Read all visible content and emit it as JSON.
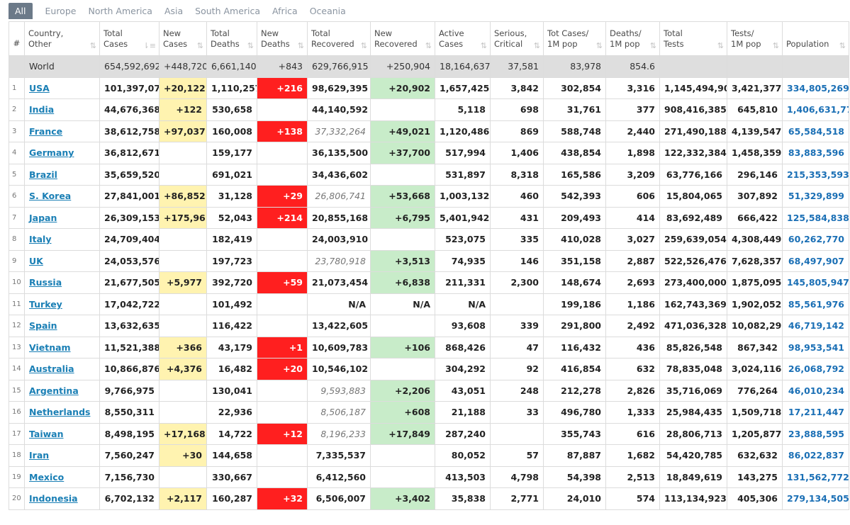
{
  "tabs": [
    {
      "label": "All",
      "active": true
    },
    {
      "label": "Europe",
      "active": false
    },
    {
      "label": "North America",
      "active": false
    },
    {
      "label": "Asia",
      "active": false
    },
    {
      "label": "South America",
      "active": false
    },
    {
      "label": "Africa",
      "active": false
    },
    {
      "label": "Oceania",
      "active": false
    }
  ],
  "headers": [
    [
      "#",
      ""
    ],
    [
      "Country,",
      "Other"
    ],
    [
      "Total",
      "Cases"
    ],
    [
      "New",
      "Cases"
    ],
    [
      "Total",
      "Deaths"
    ],
    [
      "New",
      "Deaths"
    ],
    [
      "Total",
      "Recovered"
    ],
    [
      "New",
      "Recovered"
    ],
    [
      "Active",
      "Cases"
    ],
    [
      "Serious,",
      "Critical"
    ],
    [
      "Tot Cases/",
      "1M pop"
    ],
    [
      "Deaths/",
      "1M pop"
    ],
    [
      "Total",
      "Tests"
    ],
    [
      "Tests/",
      "1M pop"
    ],
    [
      "",
      "Population"
    ]
  ],
  "world": [
    "",
    "World",
    "654,592,692",
    "+448,720",
    "6,661,140",
    "+843",
    "629,766,915",
    "+250,904",
    "18,164,637",
    "37,581",
    "83,978",
    "854.6",
    "",
    "",
    ""
  ],
  "rows": [
    [
      "1",
      "USA",
      "101,397,077",
      "+20,122",
      "1,110,257",
      "+216",
      "98,629,395",
      "+20,902",
      "1,657,425",
      "3,842",
      "302,854",
      "3,316",
      "1,145,494,902",
      "3,421,377",
      "334,805,269"
    ],
    [
      "2",
      "India",
      "44,676,368",
      "+122",
      "530,658",
      "",
      "44,140,592",
      "",
      "5,118",
      "698",
      "31,761",
      "377",
      "908,416,385",
      "645,810",
      "1,406,631,776"
    ],
    [
      "3",
      "France",
      "38,612,758",
      "+97,037",
      "160,008",
      "+138",
      "37,332,264",
      "+49,021",
      "1,120,486",
      "869",
      "588,748",
      "2,440",
      "271,490,188",
      "4,139,547",
      "65,584,518"
    ],
    [
      "4",
      "Germany",
      "36,812,671",
      "",
      "159,177",
      "",
      "36,135,500",
      "+37,700",
      "517,994",
      "1,406",
      "438,854",
      "1,898",
      "122,332,384",
      "1,458,359",
      "83,883,596"
    ],
    [
      "5",
      "Brazil",
      "35,659,520",
      "",
      "691,021",
      "",
      "34,436,602",
      "",
      "531,897",
      "8,318",
      "165,586",
      "3,209",
      "63,776,166",
      "296,146",
      "215,353,593"
    ],
    [
      "6",
      "S. Korea",
      "27,841,001",
      "+86,852",
      "31,128",
      "+29",
      "26,806,741",
      "+53,668",
      "1,003,132",
      "460",
      "542,393",
      "606",
      "15,804,065",
      "307,892",
      "51,329,899"
    ],
    [
      "7",
      "Japan",
      "26,309,153",
      "+175,961",
      "52,043",
      "+214",
      "20,855,168",
      "+6,795",
      "5,401,942",
      "431",
      "209,493",
      "414",
      "83,692,489",
      "666,422",
      "125,584,838"
    ],
    [
      "8",
      "Italy",
      "24,709,404",
      "",
      "182,419",
      "",
      "24,003,910",
      "",
      "523,075",
      "335",
      "410,028",
      "3,027",
      "259,639,054",
      "4,308,449",
      "60,262,770"
    ],
    [
      "9",
      "UK",
      "24,053,576",
      "",
      "197,723",
      "",
      "23,780,918",
      "+3,513",
      "74,935",
      "146",
      "351,158",
      "2,887",
      "522,526,476",
      "7,628,357",
      "68,497,907"
    ],
    [
      "10",
      "Russia",
      "21,677,505",
      "+5,977",
      "392,720",
      "+59",
      "21,073,454",
      "+6,838",
      "211,331",
      "2,300",
      "148,674",
      "2,693",
      "273,400,000",
      "1,875,095",
      "145,805,947"
    ],
    [
      "11",
      "Turkey",
      "17,042,722",
      "",
      "101,492",
      "",
      "N/A",
      "N/A",
      "N/A",
      "",
      "199,186",
      "1,186",
      "162,743,369",
      "1,902,052",
      "85,561,976"
    ],
    [
      "12",
      "Spain",
      "13,632,635",
      "",
      "116,422",
      "",
      "13,422,605",
      "",
      "93,608",
      "339",
      "291,800",
      "2,492",
      "471,036,328",
      "10,082,298",
      "46,719,142"
    ],
    [
      "13",
      "Vietnam",
      "11,521,388",
      "+366",
      "43,179",
      "+1",
      "10,609,783",
      "+106",
      "868,426",
      "47",
      "116,432",
      "436",
      "85,826,548",
      "867,342",
      "98,953,541"
    ],
    [
      "14",
      "Australia",
      "10,866,876",
      "+4,376",
      "16,482",
      "+20",
      "10,546,102",
      "",
      "304,292",
      "92",
      "416,854",
      "632",
      "78,835,048",
      "3,024,116",
      "26,068,792"
    ],
    [
      "15",
      "Argentina",
      "9,766,975",
      "",
      "130,041",
      "",
      "9,593,883",
      "+2,206",
      "43,051",
      "248",
      "212,278",
      "2,826",
      "35,716,069",
      "776,264",
      "46,010,234"
    ],
    [
      "16",
      "Netherlands",
      "8,550,311",
      "",
      "22,936",
      "",
      "8,506,187",
      "+608",
      "21,188",
      "33",
      "496,780",
      "1,333",
      "25,984,435",
      "1,509,718",
      "17,211,447"
    ],
    [
      "17",
      "Taiwan",
      "8,498,195",
      "+17,168",
      "14,722",
      "+12",
      "8,196,233",
      "+17,849",
      "287,240",
      "",
      "355,743",
      "616",
      "28,806,713",
      "1,205,877",
      "23,888,595"
    ],
    [
      "18",
      "Iran",
      "7,560,247",
      "+30",
      "144,658",
      "",
      "7,335,537",
      "",
      "80,052",
      "57",
      "87,887",
      "1,682",
      "54,420,785",
      "632,632",
      "86,022,837"
    ],
    [
      "19",
      "Mexico",
      "7,156,730",
      "",
      "330,667",
      "",
      "6,412,560",
      "",
      "413,503",
      "4,798",
      "54,398",
      "2,513",
      "18,849,619",
      "143,275",
      "131,562,772"
    ],
    [
      "20",
      "Indonesia",
      "6,702,132",
      "+2,117",
      "160,287",
      "+32",
      "6,506,007",
      "+3,402",
      "35,838",
      "2,771",
      "24,010",
      "574",
      "113,134,923",
      "405,306",
      "279,134,505"
    ]
  ],
  "italic_recovered_rows": [
    "France",
    "S. Korea",
    "UK",
    "Argentina",
    "Netherlands",
    "Taiwan"
  ],
  "colors": {
    "new_cases": "#fff3b0",
    "new_deaths": "#ff1f1f",
    "new_recovered": "#c8ecc9",
    "world_row": "#dedede",
    "link": "#1a7fb5"
  }
}
